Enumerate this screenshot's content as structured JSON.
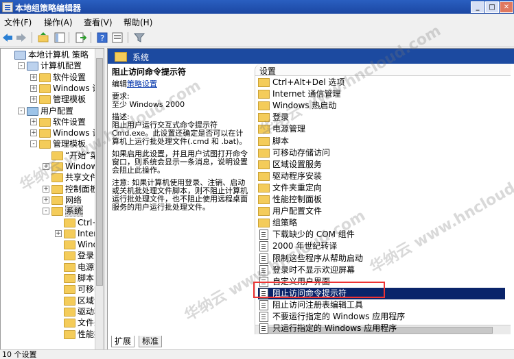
{
  "window": {
    "title": "本地组策略编辑器",
    "minimize": "_",
    "maximize": "□",
    "close": "✕"
  },
  "menu": [
    "文件(F)",
    "操作(A)",
    "查看(V)",
    "帮助(H)"
  ],
  "tree": [
    {
      "label": "本地计算机 策略",
      "indent": 0,
      "exp": "",
      "kind": "computer"
    },
    {
      "label": "计算机配置",
      "indent": 1,
      "exp": "-",
      "kind": "computer"
    },
    {
      "label": "软件设置",
      "indent": 2,
      "exp": "+",
      "kind": "folder"
    },
    {
      "label": "Windows 设置",
      "indent": 2,
      "exp": "+",
      "kind": "folder"
    },
    {
      "label": "管理模板",
      "indent": 2,
      "exp": "+",
      "kind": "folder"
    },
    {
      "label": "用户配置",
      "indent": 1,
      "exp": "-",
      "kind": "user"
    },
    {
      "label": "软件设置",
      "indent": 2,
      "exp": "+",
      "kind": "folder"
    },
    {
      "label": "Windows 设置",
      "indent": 2,
      "exp": "+",
      "kind": "folder"
    },
    {
      "label": "管理模板",
      "indent": 2,
      "exp": "-",
      "kind": "folder"
    },
    {
      "label": "“开始”菜",
      "indent": 3,
      "exp": "",
      "kind": "folder"
    },
    {
      "label": "Windows 组",
      "indent": 3,
      "exp": "+",
      "kind": "folder"
    },
    {
      "label": "共享文件夹",
      "indent": 3,
      "exp": "",
      "kind": "folder"
    },
    {
      "label": "控制面板",
      "indent": 3,
      "exp": "+",
      "kind": "folder"
    },
    {
      "label": "网络",
      "indent": 3,
      "exp": "+",
      "kind": "folder"
    },
    {
      "label": "系统",
      "indent": 3,
      "exp": "-",
      "kind": "folder"
    },
    {
      "label": "Ctrl+Alt",
      "indent": 4,
      "exp": "",
      "kind": "folder"
    },
    {
      "label": "Intern",
      "indent": 4,
      "exp": "+",
      "kind": "folder"
    },
    {
      "label": "Window",
      "indent": 4,
      "exp": "",
      "kind": "folder"
    },
    {
      "label": "登录",
      "indent": 4,
      "exp": "",
      "kind": "folder"
    },
    {
      "label": "电源管",
      "indent": 4,
      "exp": "",
      "kind": "folder"
    },
    {
      "label": "脚本",
      "indent": 4,
      "exp": "",
      "kind": "folder"
    },
    {
      "label": "可移动",
      "indent": 4,
      "exp": "",
      "kind": "folder"
    },
    {
      "label": "区域设",
      "indent": 4,
      "exp": "",
      "kind": "folder"
    },
    {
      "label": "驱动程",
      "indent": 4,
      "exp": "",
      "kind": "folder"
    },
    {
      "label": "文件夹",
      "indent": 4,
      "exp": "",
      "kind": "folder"
    },
    {
      "label": "性能控",
      "indent": 4,
      "exp": "",
      "kind": "folder"
    }
  ],
  "header": {
    "title": "系统"
  },
  "description": {
    "title": "阻止访问命令提示符",
    "edit_prefix": "编辑",
    "edit_link": "策略设置",
    "req_label": "要求:",
    "req_value": "至少 Windows 2000",
    "desc_label": "描述:",
    "desc_body": "阻止用户运行交互式命令提示符 Cmd.exe。此设置还确定是否可以在计算机上运行批处理文件(.cmd 和 .bat)。",
    "para2": "如果启用此设置，并且用户试图打开命令窗口，则系统会显示一条消息，说明设置会阻止此操作。",
    "para3": "注意: 如果计算机使用登录、注销、启动或关机批处理文件脚本，则不阻止计算机运行批处理文件，也不阻止使用远程桌面服务的用户运行批处理文件。"
  },
  "list": {
    "column_header": "设置",
    "items": [
      {
        "label": "Ctrl+Alt+Del 选项",
        "kind": "folder"
      },
      {
        "label": "Internet 通信管理",
        "kind": "folder"
      },
      {
        "label": "Windows 热启动",
        "kind": "folder"
      },
      {
        "label": "登录",
        "kind": "folder"
      },
      {
        "label": "电源管理",
        "kind": "folder"
      },
      {
        "label": "脚本",
        "kind": "folder"
      },
      {
        "label": "可移动存储访问",
        "kind": "folder"
      },
      {
        "label": "区域设置服务",
        "kind": "folder"
      },
      {
        "label": "驱动程序安装",
        "kind": "folder"
      },
      {
        "label": "文件夹重定向",
        "kind": "folder"
      },
      {
        "label": "性能控制面板",
        "kind": "folder"
      },
      {
        "label": "用户配置文件",
        "kind": "folder"
      },
      {
        "label": "组策略",
        "kind": "folder"
      },
      {
        "label": "下载缺少的 COM 组件",
        "kind": "setting"
      },
      {
        "label": "2000 年世纪转译",
        "kind": "setting"
      },
      {
        "label": "限制这些程序从帮助启动",
        "kind": "setting"
      },
      {
        "label": "登录时不显示欢迎屏幕",
        "kind": "setting"
      },
      {
        "label": "自定义用户界面",
        "kind": "setting"
      },
      {
        "label": "阻止访问命令提示符",
        "kind": "setting",
        "selected": true
      },
      {
        "label": "阻止访问注册表编辑工具",
        "kind": "setting"
      },
      {
        "label": "不要运行指定的 Windows 应用程序",
        "kind": "setting"
      },
      {
        "label": "只运行指定的 Windows 应用程序",
        "kind": "setting"
      }
    ]
  },
  "tabs": {
    "extended": "扩展",
    "standard": "标准"
  },
  "status": {
    "text": "10 个设置"
  },
  "watermark": "华纳云 www.hncloud.com"
}
